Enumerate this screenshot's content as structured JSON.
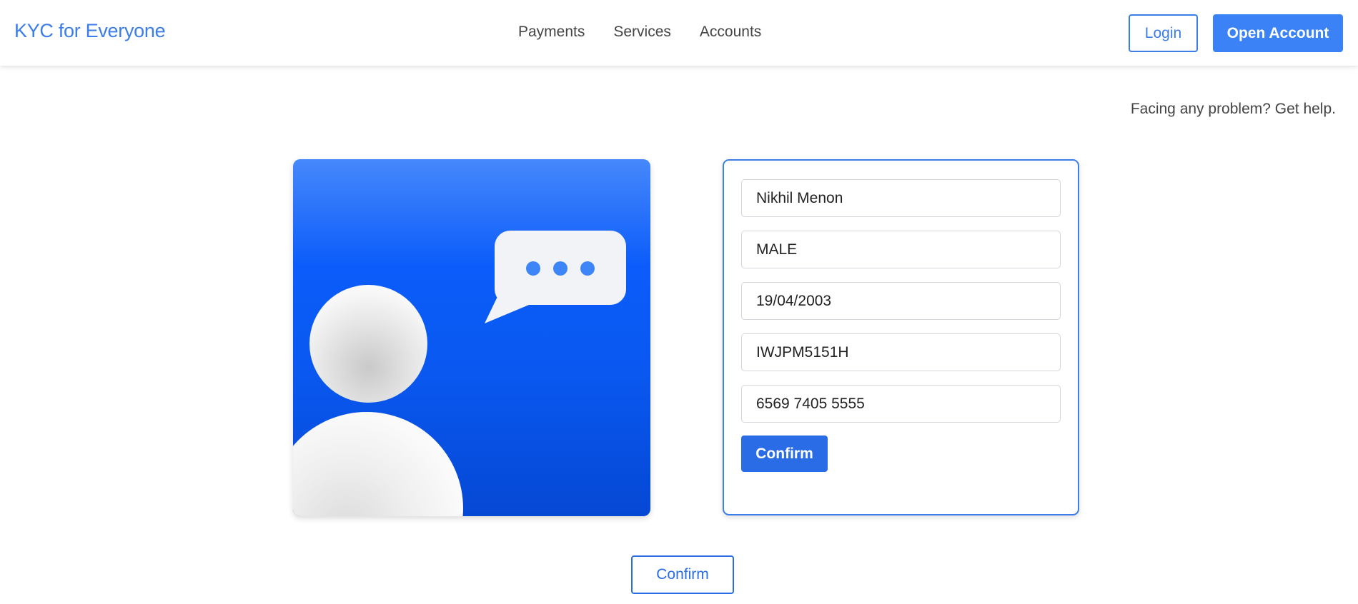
{
  "navbar": {
    "brand": "KYC for Everyone",
    "links": [
      "Payments",
      "Services",
      "Accounts"
    ],
    "login_label": "Login",
    "open_account_label": "Open Account"
  },
  "help_text": "Facing any problem? Get help.",
  "form": {
    "fields": [
      {
        "name": "full-name",
        "value": "Nikhil Menon"
      },
      {
        "name": "gender",
        "value": "MALE"
      },
      {
        "name": "date-of-birth",
        "value": "19/04/2003"
      },
      {
        "name": "pan-number",
        "value": "IWJPM5151H"
      },
      {
        "name": "aadhaar-number",
        "value": "6569 7405 5555"
      }
    ],
    "confirm_label": "Confirm"
  },
  "bottom_confirm_label": "Confirm",
  "colors": {
    "accent": "#3b7de9",
    "primary_button": "#3b82f6",
    "confirm_button": "#2a6ce6"
  },
  "icons": {
    "illustration": "user-chat-illustration",
    "bubble": "speech-bubble-icon"
  }
}
